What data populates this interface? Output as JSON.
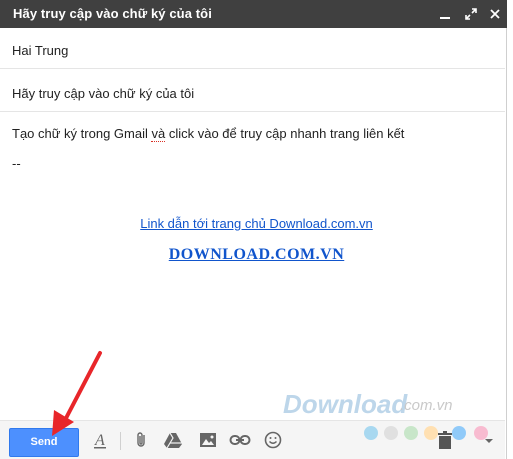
{
  "window": {
    "title": "Hãy truy cập vào chữ ký của tôi",
    "icons": [
      "minimize-icon",
      "expand-icon",
      "close-icon"
    ]
  },
  "fields": {
    "recipient": "Hai Trung",
    "subject": "Hãy truy cập vào chữ ký của tôi"
  },
  "body": {
    "text_before": "Tạo chữ ký trong Gmail ",
    "text_underlined": "và",
    "text_after": " click vào để truy cập nhanh trang liên kết",
    "separator": "--",
    "home_link": "Link dẫn tới trang chủ Download.com.vn",
    "site_link": "DOWNLOAD.COM.VN"
  },
  "watermark": {
    "logo": "Download",
    "suffix": ".com.vn"
  },
  "toolbar": {
    "send_label": "Send",
    "tools": [
      "formatting-icon",
      "attach-icon",
      "drive-icon",
      "photo-icon",
      "link-icon",
      "emoji-icon",
      "trash-icon",
      "more-options-icon"
    ]
  },
  "colors": {
    "titlebar": "#404040",
    "send_button": "#4d90fe",
    "link": "#1155cc",
    "annotation_arrow": "#e8262a",
    "watermark_dots": [
      "#a8d8f0",
      "#e0e0e0",
      "#c8e6c9",
      "#ffe0b2",
      "#90caf9",
      "#f8bbd0"
    ]
  }
}
